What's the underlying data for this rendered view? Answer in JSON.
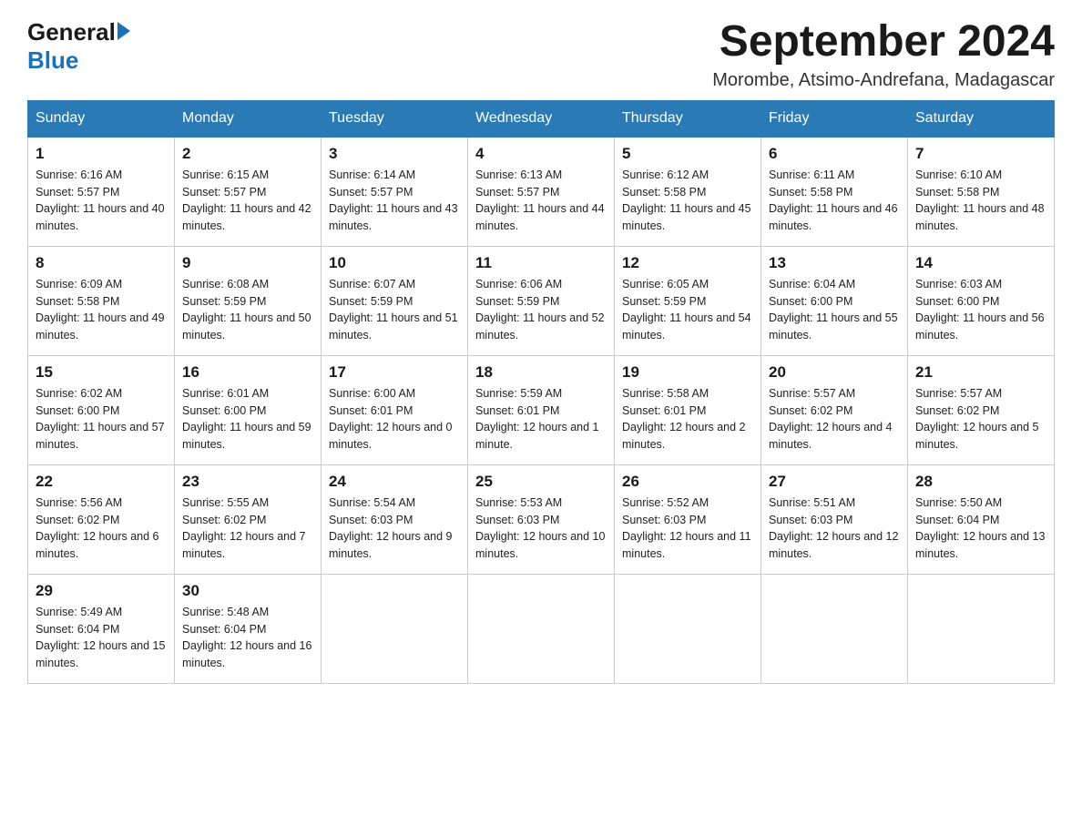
{
  "header": {
    "logo_general": "General",
    "logo_blue": "Blue",
    "month_title": "September 2024",
    "subtitle": "Morombe, Atsimo-Andrefana, Madagascar"
  },
  "days_of_week": [
    "Sunday",
    "Monday",
    "Tuesday",
    "Wednesday",
    "Thursday",
    "Friday",
    "Saturday"
  ],
  "weeks": [
    [
      {
        "day": "1",
        "sunrise": "6:16 AM",
        "sunset": "5:57 PM",
        "daylight": "11 hours and 40 minutes."
      },
      {
        "day": "2",
        "sunrise": "6:15 AM",
        "sunset": "5:57 PM",
        "daylight": "11 hours and 42 minutes."
      },
      {
        "day": "3",
        "sunrise": "6:14 AM",
        "sunset": "5:57 PM",
        "daylight": "11 hours and 43 minutes."
      },
      {
        "day": "4",
        "sunrise": "6:13 AM",
        "sunset": "5:57 PM",
        "daylight": "11 hours and 44 minutes."
      },
      {
        "day": "5",
        "sunrise": "6:12 AM",
        "sunset": "5:58 PM",
        "daylight": "11 hours and 45 minutes."
      },
      {
        "day": "6",
        "sunrise": "6:11 AM",
        "sunset": "5:58 PM",
        "daylight": "11 hours and 46 minutes."
      },
      {
        "day": "7",
        "sunrise": "6:10 AM",
        "sunset": "5:58 PM",
        "daylight": "11 hours and 48 minutes."
      }
    ],
    [
      {
        "day": "8",
        "sunrise": "6:09 AM",
        "sunset": "5:58 PM",
        "daylight": "11 hours and 49 minutes."
      },
      {
        "day": "9",
        "sunrise": "6:08 AM",
        "sunset": "5:59 PM",
        "daylight": "11 hours and 50 minutes."
      },
      {
        "day": "10",
        "sunrise": "6:07 AM",
        "sunset": "5:59 PM",
        "daylight": "11 hours and 51 minutes."
      },
      {
        "day": "11",
        "sunrise": "6:06 AM",
        "sunset": "5:59 PM",
        "daylight": "11 hours and 52 minutes."
      },
      {
        "day": "12",
        "sunrise": "6:05 AM",
        "sunset": "5:59 PM",
        "daylight": "11 hours and 54 minutes."
      },
      {
        "day": "13",
        "sunrise": "6:04 AM",
        "sunset": "6:00 PM",
        "daylight": "11 hours and 55 minutes."
      },
      {
        "day": "14",
        "sunrise": "6:03 AM",
        "sunset": "6:00 PM",
        "daylight": "11 hours and 56 minutes."
      }
    ],
    [
      {
        "day": "15",
        "sunrise": "6:02 AM",
        "sunset": "6:00 PM",
        "daylight": "11 hours and 57 minutes."
      },
      {
        "day": "16",
        "sunrise": "6:01 AM",
        "sunset": "6:00 PM",
        "daylight": "11 hours and 59 minutes."
      },
      {
        "day": "17",
        "sunrise": "6:00 AM",
        "sunset": "6:01 PM",
        "daylight": "12 hours and 0 minutes."
      },
      {
        "day": "18",
        "sunrise": "5:59 AM",
        "sunset": "6:01 PM",
        "daylight": "12 hours and 1 minute."
      },
      {
        "day": "19",
        "sunrise": "5:58 AM",
        "sunset": "6:01 PM",
        "daylight": "12 hours and 2 minutes."
      },
      {
        "day": "20",
        "sunrise": "5:57 AM",
        "sunset": "6:02 PM",
        "daylight": "12 hours and 4 minutes."
      },
      {
        "day": "21",
        "sunrise": "5:57 AM",
        "sunset": "6:02 PM",
        "daylight": "12 hours and 5 minutes."
      }
    ],
    [
      {
        "day": "22",
        "sunrise": "5:56 AM",
        "sunset": "6:02 PM",
        "daylight": "12 hours and 6 minutes."
      },
      {
        "day": "23",
        "sunrise": "5:55 AM",
        "sunset": "6:02 PM",
        "daylight": "12 hours and 7 minutes."
      },
      {
        "day": "24",
        "sunrise": "5:54 AM",
        "sunset": "6:03 PM",
        "daylight": "12 hours and 9 minutes."
      },
      {
        "day": "25",
        "sunrise": "5:53 AM",
        "sunset": "6:03 PM",
        "daylight": "12 hours and 10 minutes."
      },
      {
        "day": "26",
        "sunrise": "5:52 AM",
        "sunset": "6:03 PM",
        "daylight": "12 hours and 11 minutes."
      },
      {
        "day": "27",
        "sunrise": "5:51 AM",
        "sunset": "6:03 PM",
        "daylight": "12 hours and 12 minutes."
      },
      {
        "day": "28",
        "sunrise": "5:50 AM",
        "sunset": "6:04 PM",
        "daylight": "12 hours and 13 minutes."
      }
    ],
    [
      {
        "day": "29",
        "sunrise": "5:49 AM",
        "sunset": "6:04 PM",
        "daylight": "12 hours and 15 minutes."
      },
      {
        "day": "30",
        "sunrise": "5:48 AM",
        "sunset": "6:04 PM",
        "daylight": "12 hours and 16 minutes."
      },
      null,
      null,
      null,
      null,
      null
    ]
  ]
}
